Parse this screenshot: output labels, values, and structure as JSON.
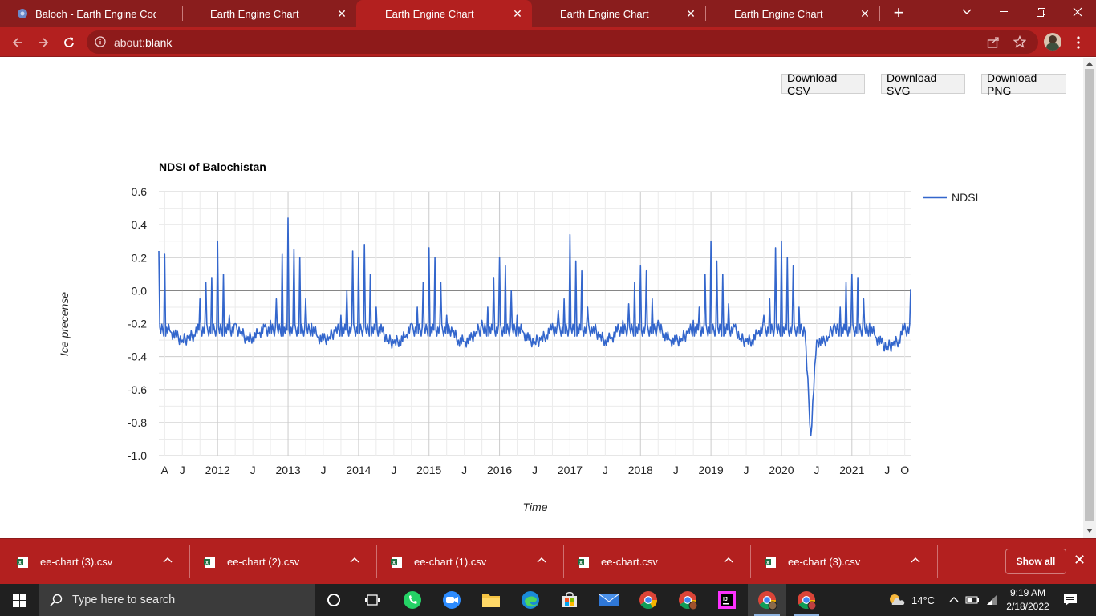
{
  "browser": {
    "tabs": [
      {
        "title": "Baloch - Earth Engine Code E",
        "active": false
      },
      {
        "title": "Earth Engine Chart",
        "active": false
      },
      {
        "title": "Earth Engine Chart",
        "active": true
      },
      {
        "title": "Earth Engine Chart",
        "active": false
      },
      {
        "title": "Earth Engine Chart",
        "active": false
      }
    ],
    "url_prefix": "about:",
    "url_host": "blank",
    "theme_color": "#b3201f"
  },
  "page": {
    "buttons": {
      "csv": "Download CSV",
      "svg": "Download SVG",
      "png": "Download PNG"
    }
  },
  "chart_data": {
    "type": "line",
    "title": "NDSI of Balochistan",
    "xlabel": "Time",
    "ylabel": "Ice precense",
    "ylim": [
      -1.0,
      0.6
    ],
    "yticks": [
      "0.6",
      "0.4",
      "0.2",
      "0.0",
      "-0.2",
      "-0.4",
      "-0.6",
      "-0.8",
      "-1.0"
    ],
    "xticks": [
      "A",
      "J",
      "2012",
      "J",
      "2013",
      "J",
      "2014",
      "J",
      "2015",
      "J",
      "2016",
      "J",
      "2017",
      "J",
      "2018",
      "J",
      "2019",
      "J",
      "2020",
      "J",
      "2021",
      "J",
      "O"
    ],
    "xrange": [
      "2011-03",
      "2021-11"
    ],
    "grid": true,
    "legend_position": "right",
    "color": "#3366cc",
    "series": [
      {
        "name": "NDSI",
        "x": [
          "2011-03",
          "2011-04",
          "2011-05",
          "2011-06",
          "2011-07",
          "2011-08",
          "2011-09",
          "2011-10",
          "2011-11",
          "2011-12",
          "2012-01",
          "2012-02",
          "2012-03",
          "2012-04",
          "2012-05",
          "2012-06",
          "2012-07",
          "2012-08",
          "2012-09",
          "2012-10",
          "2012-11",
          "2012-12",
          "2013-01",
          "2013-02",
          "2013-03",
          "2013-04",
          "2013-05",
          "2013-06",
          "2013-07",
          "2013-08",
          "2013-09",
          "2013-10",
          "2013-11",
          "2013-12",
          "2014-01",
          "2014-02",
          "2014-03",
          "2014-04",
          "2014-05",
          "2014-06",
          "2014-07",
          "2014-08",
          "2014-09",
          "2014-10",
          "2014-11",
          "2014-12",
          "2015-01",
          "2015-02",
          "2015-03",
          "2015-04",
          "2015-05",
          "2015-06",
          "2015-07",
          "2015-08",
          "2015-09",
          "2015-10",
          "2015-11",
          "2015-12",
          "2016-01",
          "2016-02",
          "2016-03",
          "2016-04",
          "2016-05",
          "2016-06",
          "2016-07",
          "2016-08",
          "2016-09",
          "2016-10",
          "2016-11",
          "2016-12",
          "2017-01",
          "2017-02",
          "2017-03",
          "2017-04",
          "2017-05",
          "2017-06",
          "2017-07",
          "2017-08",
          "2017-09",
          "2017-10",
          "2017-11",
          "2017-12",
          "2018-01",
          "2018-02",
          "2018-03",
          "2018-04",
          "2018-05",
          "2018-06",
          "2018-07",
          "2018-08",
          "2018-09",
          "2018-10",
          "2018-11",
          "2018-12",
          "2019-01",
          "2019-02",
          "2019-03",
          "2019-04",
          "2019-05",
          "2019-06",
          "2019-07",
          "2019-08",
          "2019-09",
          "2019-10",
          "2019-11",
          "2019-12",
          "2020-01",
          "2020-02",
          "2020-03",
          "2020-04",
          "2020-05",
          "2020-06",
          "2020-07",
          "2020-08",
          "2020-09",
          "2020-10",
          "2020-11",
          "2020-12",
          "2021-01",
          "2021-02",
          "2021-03",
          "2021-04",
          "2021-05",
          "2021-06",
          "2021-07",
          "2021-08",
          "2021-09",
          "2021-10",
          "2021-11"
        ],
        "y": [
          0.24,
          0.22,
          -0.25,
          -0.28,
          -0.3,
          -0.29,
          -0.27,
          -0.05,
          0.05,
          0.08,
          0.3,
          0.1,
          -0.15,
          -0.2,
          -0.25,
          -0.3,
          -0.28,
          -0.26,
          -0.22,
          -0.18,
          -0.05,
          0.22,
          0.44,
          0.25,
          0.2,
          -0.05,
          -0.2,
          -0.28,
          -0.3,
          -0.28,
          -0.25,
          -0.15,
          0.0,
          0.24,
          0.2,
          0.28,
          0.1,
          -0.1,
          -0.25,
          -0.3,
          -0.32,
          -0.3,
          -0.28,
          -0.2,
          -0.1,
          0.05,
          0.26,
          0.2,
          0.05,
          -0.15,
          -0.25,
          -0.3,
          -0.31,
          -0.3,
          -0.25,
          -0.18,
          -0.1,
          0.08,
          0.2,
          0.15,
          0.0,
          -0.15,
          -0.25,
          -0.3,
          -0.31,
          -0.3,
          -0.27,
          -0.2,
          -0.12,
          -0.05,
          0.34,
          0.18,
          0.12,
          -0.1,
          -0.22,
          -0.28,
          -0.3,
          -0.29,
          -0.25,
          -0.18,
          -0.08,
          0.05,
          0.15,
          0.12,
          -0.05,
          -0.18,
          -0.26,
          -0.3,
          -0.31,
          -0.29,
          -0.26,
          -0.18,
          -0.1,
          0.1,
          0.3,
          0.18,
          0.1,
          -0.08,
          -0.22,
          -0.29,
          -0.31,
          -0.3,
          -0.26,
          -0.15,
          -0.05,
          0.26,
          0.3,
          0.2,
          0.15,
          -0.1,
          -0.25,
          -0.88,
          -0.3,
          -0.32,
          -0.28,
          -0.2,
          -0.1,
          0.05,
          0.1,
          0.08,
          -0.05,
          -0.2,
          -0.28,
          -0.32,
          -0.34,
          -0.33,
          -0.3,
          -0.2,
          0.01
        ]
      }
    ]
  },
  "downloads": {
    "items": [
      "ee-chart (3).csv",
      "ee-chart (2).csv",
      "ee-chart (1).csv",
      "ee-chart.csv",
      "ee-chart (3).csv"
    ],
    "show_all": "Show all"
  },
  "taskbar": {
    "search_placeholder": "Type here to search",
    "temperature": "14°C",
    "time": "9:19 AM",
    "date": "2/18/2022"
  }
}
